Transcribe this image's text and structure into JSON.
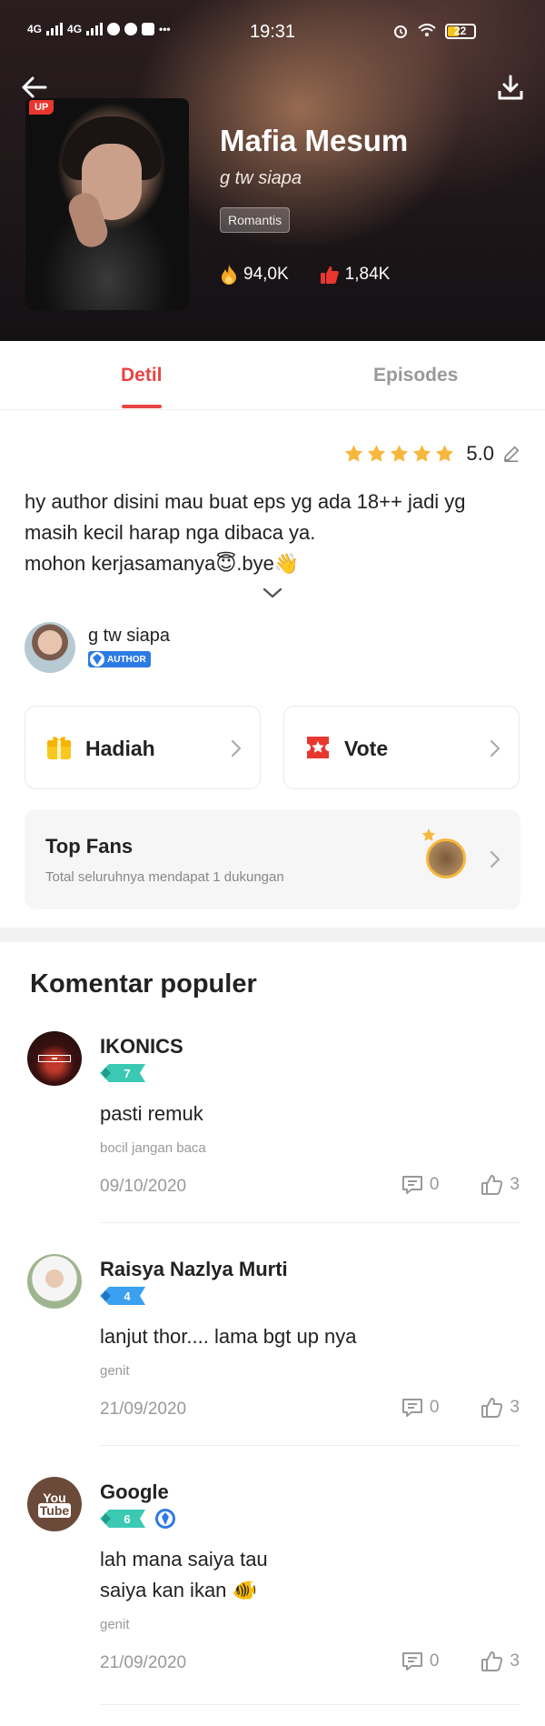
{
  "status_bar": {
    "time": "19:31",
    "network_1": "4G",
    "network_2": "4G",
    "battery": "22"
  },
  "novel": {
    "badge": "UP",
    "title": "Mafia Mesum",
    "author": "g tw siapa",
    "genre": "Romantis",
    "views": "94,0K",
    "likes": "1,84K"
  },
  "tabs": [
    {
      "label": "Detil",
      "active": true
    },
    {
      "label": "Episodes",
      "active": false
    }
  ],
  "detail": {
    "rating": "5.0",
    "stars": 5,
    "synopsis": "hy author disini mau buat eps yg ada 18++ jadi yg\nmasih kecil harap nga dibaca ya.\nmohon kerjasamanya😇.bye👋",
    "author_name": "g tw siapa",
    "author_badge": "AUTHOR",
    "gift_label": "Hadiah",
    "vote_label": "Vote",
    "top_fans_title": "Top Fans",
    "top_fans_subtitle": "Total seluruhnya mendapat 1 dukungan"
  },
  "comments_section": {
    "title": "Komentar populer",
    "items": [
      {
        "name": "IKONICS",
        "level": "7",
        "text": "pasti remuk",
        "sub": "bocil jangan baca",
        "date": "09/10/2020",
        "replies": "0",
        "likes": "3"
      },
      {
        "name": "Raisya Nazlya Murti",
        "level": "4",
        "text": "lanjut thor.... lama bgt up nya",
        "sub": "genit",
        "date": "21/09/2020",
        "replies": "0",
        "likes": "3"
      },
      {
        "name": "Google",
        "level": "6",
        "text": "lah mana saiya tau\nsaiya kan ikan 🐠",
        "sub": "genit",
        "date": "21/09/2020",
        "replies": "0",
        "likes": "3"
      }
    ]
  },
  "colors": {
    "accent": "#e84545",
    "star": "#f6b73c",
    "author_badge": "#2c7be5",
    "level_teal": "#3cc9b4",
    "level_blue": "#3aa0f0"
  }
}
